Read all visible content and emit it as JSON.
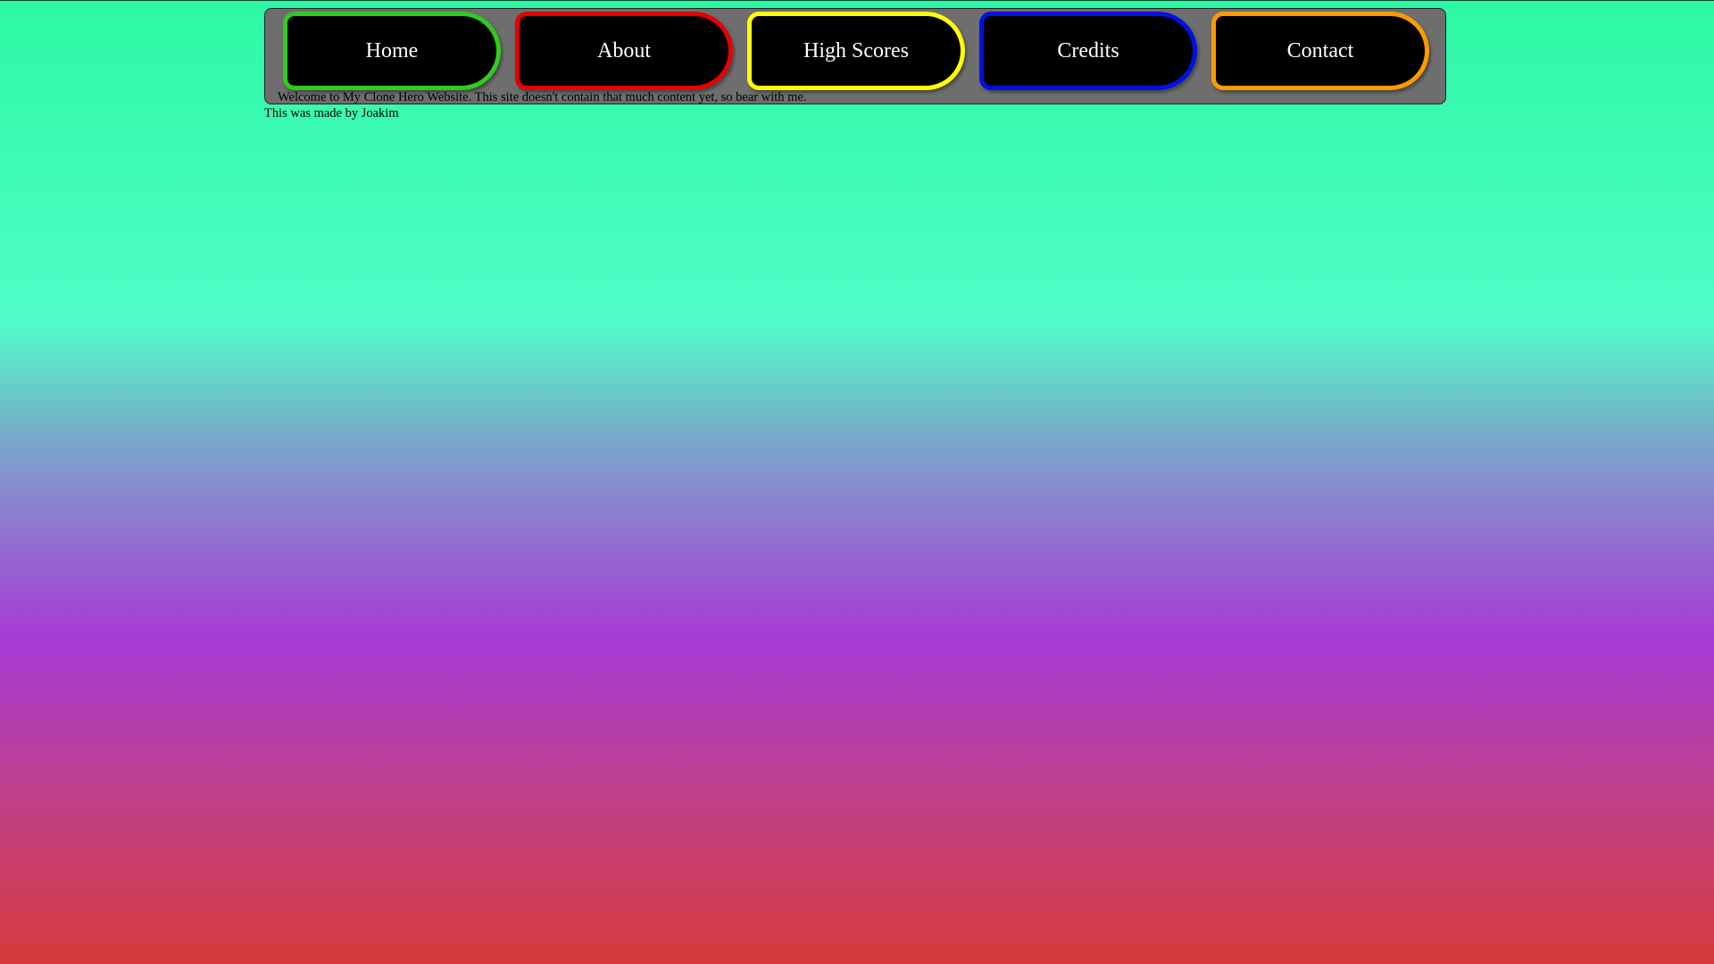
{
  "nav": {
    "items": [
      {
        "label": "Home",
        "border_color": "#2ecc1f"
      },
      {
        "label": "About",
        "border_color": "#e60000"
      },
      {
        "label": "High Scores",
        "border_color": "#ffff00"
      },
      {
        "label": "Credits",
        "border_color": "#0010e6"
      },
      {
        "label": "Contact",
        "border_color": "#ff9a00"
      }
    ]
  },
  "welcome_text": "Welcome to My Clone Hero Website. This site doesn't contain that much content yet, so bear with me.",
  "footer_text": "This was made by Joakim",
  "colors": {
    "panel_background": "#6e6e6e",
    "button_background": "#000000",
    "button_text": "#ffffff",
    "gradient": [
      "#2cf9a3",
      "#50fdc8",
      "#7ea0cc",
      "#a63bd7",
      "#c0408d",
      "#d63a3a"
    ]
  }
}
